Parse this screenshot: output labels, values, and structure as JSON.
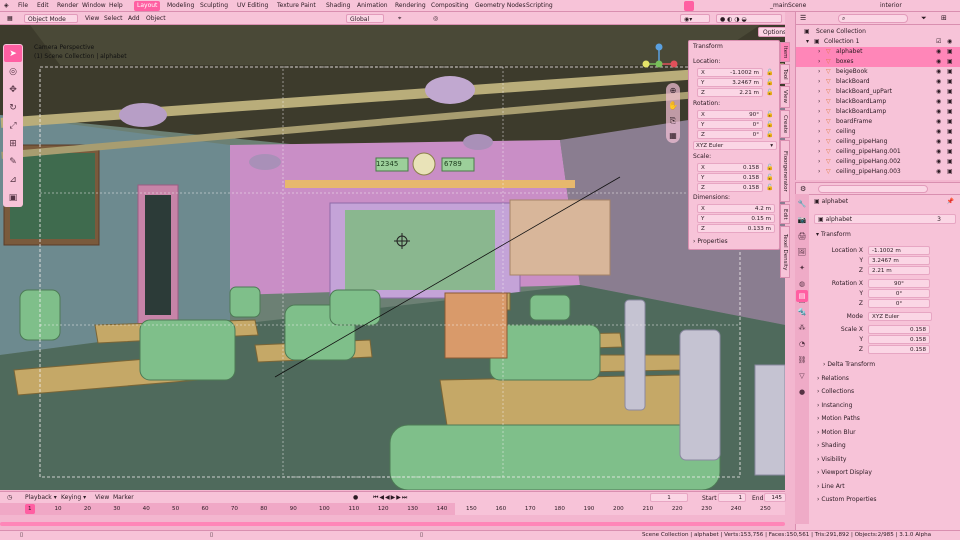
{
  "topbar": {
    "menus": [
      "File",
      "Edit",
      "Render",
      "Window",
      "Help"
    ],
    "workspaces": [
      "Layout",
      "Modeling",
      "Sculpting",
      "UV Editing",
      "Texture Paint",
      "Shading",
      "Animation",
      "Rendering",
      "Compositing",
      "Geometry Nodes",
      "Scripting"
    ],
    "active_workspace": "Layout",
    "scene_name": "_mainScene",
    "view_layer": "interior"
  },
  "viewport_header": {
    "mode": "Object Mode",
    "menus": [
      "View",
      "Select",
      "Add",
      "Object"
    ],
    "orientation": "Global",
    "options": "Options"
  },
  "viewport": {
    "camera_label": "Camera Perspective",
    "collection_label": "(1) Scene Collection | alphabet",
    "clock_left": "12345",
    "clock_right": "6789"
  },
  "npanel": {
    "header": "Transform",
    "location_label": "Location:",
    "location": [
      {
        "k": "X",
        "v": "-1.1002 m"
      },
      {
        "k": "Y",
        "v": "3.2467 m"
      },
      {
        "k": "Z",
        "v": "2.21 m"
      }
    ],
    "rotation_label": "Rotation:",
    "rotation": [
      {
        "k": "X",
        "v": "90°"
      },
      {
        "k": "Y",
        "v": "0°"
      },
      {
        "k": "Z",
        "v": "0°"
      }
    ],
    "rotation_mode": "XYZ Euler",
    "scale_label": "Scale:",
    "scale": [
      {
        "k": "X",
        "v": "0.158"
      },
      {
        "k": "Y",
        "v": "0.158"
      },
      {
        "k": "Z",
        "v": "0.158"
      }
    ],
    "dimensions_label": "Dimensions:",
    "dimensions": [
      {
        "k": "X",
        "v": "4.2 m"
      },
      {
        "k": "Y",
        "v": "0.15 m"
      },
      {
        "k": "Z",
        "v": "0.133 m"
      }
    ],
    "properties": "Properties"
  },
  "side_tabs": [
    "Item",
    "Tool",
    "View",
    "Create",
    "Floorgenerator",
    "Edit",
    "Texel Density"
  ],
  "outliner": {
    "title": "Scene Collection",
    "collection": "Collection 1",
    "items": [
      "alphabet",
      "boxes",
      "beigeBook",
      "blackBoard",
      "blackBoard_upPart",
      "blackBoardLamp",
      "blackBoardLamp",
      "boardFrame",
      "ceiling",
      "ceiling_pipeHang",
      "ceiling_pipeHang.001",
      "ceiling_pipeHang.002",
      "ceiling_pipeHang.003"
    ],
    "selected": "alphabet"
  },
  "properties": {
    "object_name": "alphabet",
    "data_name": "alphabet",
    "users": "3",
    "section_transform": "Transform",
    "location_x_label": "Location X",
    "y_label": "Y",
    "z_label": "Z",
    "rotation_x_label": "Rotation X",
    "mode_label": "Mode",
    "scale_x_label": "Scale X",
    "location": [
      "-1.1002 m",
      "3.2467 m",
      "2.21 m"
    ],
    "rotation": [
      "90°",
      "0°",
      "0°"
    ],
    "mode": "XYZ Euler",
    "scale": [
      "0.158",
      "0.158",
      "0.158"
    ],
    "sections": [
      "Delta Transform",
      "Relations",
      "Collections",
      "Instancing",
      "Motion Paths",
      "Motion Blur",
      "Shading",
      "Visibility",
      "Viewport Display",
      "Line Art",
      "Custom Properties"
    ]
  },
  "timeline": {
    "menus": [
      "Playback",
      "Keying",
      "View",
      "Marker"
    ],
    "current_frame": "1",
    "start_label": "Start",
    "start": "1",
    "end_label": "End",
    "end": "145",
    "ticks": [
      "1",
      "10",
      "20",
      "30",
      "40",
      "50",
      "60",
      "70",
      "80",
      "90",
      "100",
      "110",
      "120",
      "130",
      "140",
      "150",
      "160",
      "170",
      "180",
      "190",
      "200",
      "210",
      "220",
      "230",
      "240",
      "250"
    ]
  },
  "statusbar": {
    "text": "Scene Collection | alphabet | Verts:153,756 | Faces:150,561 | Tris:291,892 | Objects:2/985 | 3.1.0 Alpha"
  },
  "colors": {
    "accent": "#ff5fa2",
    "panel": "#f7c3d8",
    "selected": "#ff86b8"
  }
}
